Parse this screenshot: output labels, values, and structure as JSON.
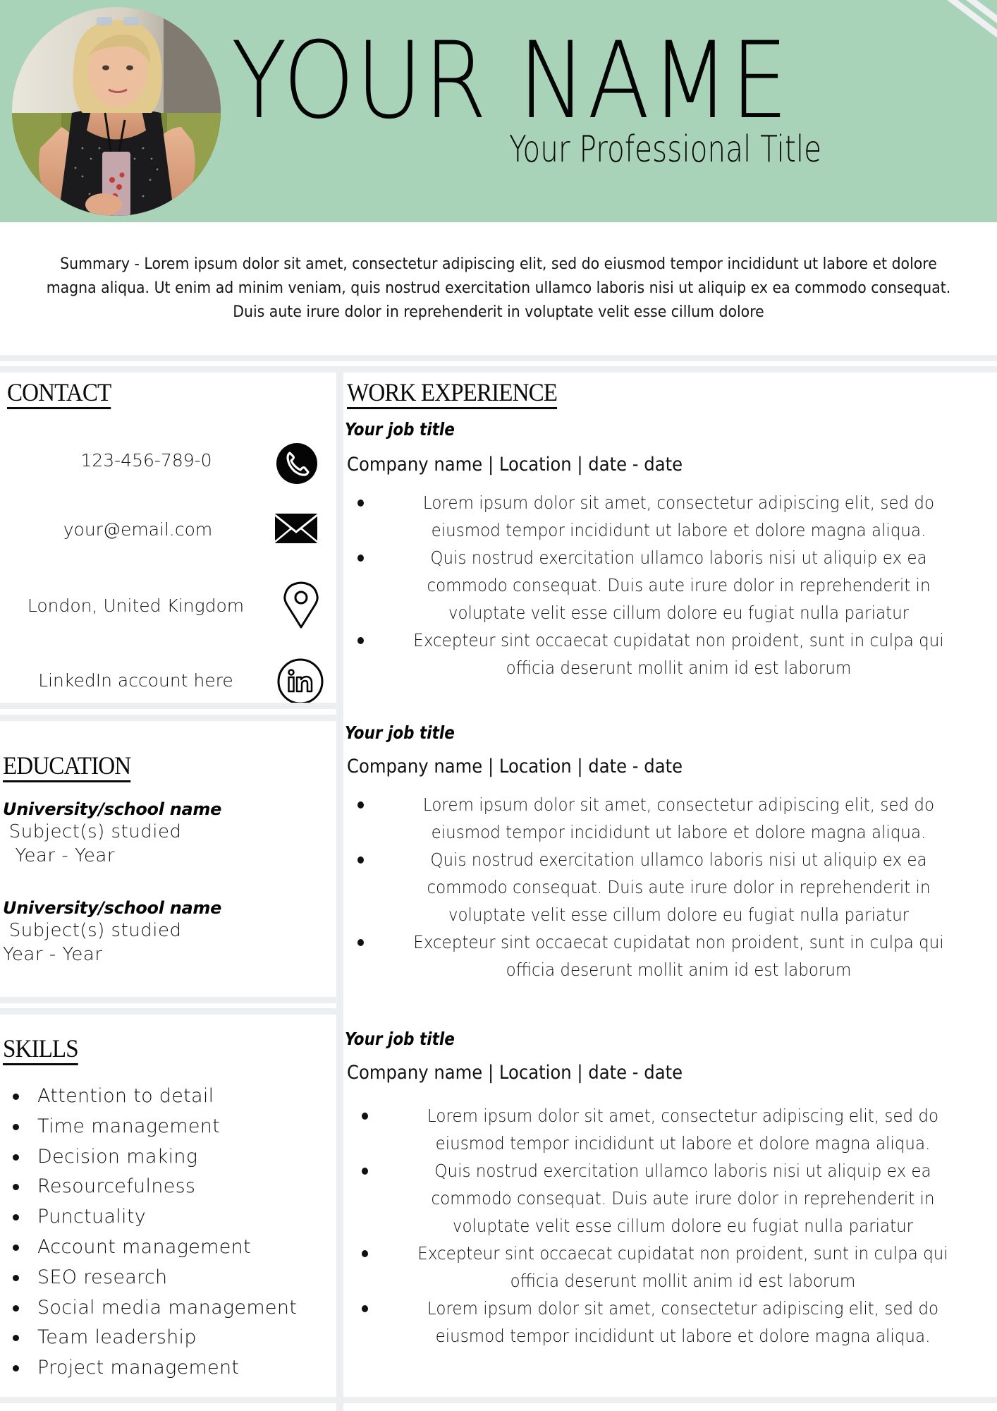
{
  "header": {
    "name": "YOUR NAME",
    "professional_title": "Your Professional Title",
    "accent_color": "#a8d3b9",
    "photo": "profile-photo"
  },
  "summary": "Summary - Lorem ipsum dolor sit amet, consectetur adipiscing elit, sed do eiusmod tempor incididunt ut labore et dolore magna aliqua. Ut enim ad minim veniam, quis nostrud exercitation ullamco laboris nisi ut aliquip ex ea commodo consequat. Duis aute irure dolor in reprehenderit in voluptate velit esse cillum dolore",
  "contact": {
    "heading": "CONTACT",
    "items": [
      {
        "text": "123-456-789-0",
        "icon": "phone-icon"
      },
      {
        "text": "your@email.com",
        "icon": "email-icon"
      },
      {
        "text": "London, United Kingdom",
        "icon": "location-pin-icon"
      },
      {
        "text": "LinkedIn account here",
        "icon": "linkedin-icon"
      }
    ]
  },
  "education": {
    "heading": "EDUCATION",
    "items": [
      {
        "school": "University/school name",
        "subjects": " Subject(s) studied",
        "years": "  Year - Year"
      },
      {
        "school": "University/school name",
        "subjects": " Subject(s) studied",
        "years": "Year - Year"
      }
    ]
  },
  "skills": {
    "heading": "SKILLS",
    "items": [
      "Attention to detail",
      "Time management",
      "Decision making",
      "Resourcefulness",
      "Punctuality",
      "Account management",
      "SEO research",
      "Social media management",
      "Team leadership",
      "Project management"
    ]
  },
  "work": {
    "heading": "WORK EXPERIENCE",
    "jobs": [
      {
        "title": "Your job title",
        "meta": "Company name | Location | date - date",
        "bullets": [
          "Lorem ipsum dolor sit amet, consectetur adipiscing elit, sed do eiusmod tempor incididunt ut labore et dolore magna aliqua.",
          "Quis nostrud exercitation ullamco laboris nisi ut aliquip ex ea commodo consequat. Duis aute irure dolor in reprehenderit in voluptate velit esse cillum dolore eu fugiat nulla pariatur",
          "Excepteur sint occaecat cupidatat non proident, sunt in culpa qui officia deserunt mollit anim id est laborum"
        ]
      },
      {
        "title": "Your job title",
        "meta": "Company name | Location | date - date",
        "bullets": [
          "Lorem ipsum dolor sit amet, consectetur adipiscing elit, sed do eiusmod tempor incididunt ut labore et dolore magna aliqua.",
          "Quis nostrud exercitation ullamco laboris nisi ut aliquip ex ea commodo consequat. Duis aute irure dolor in reprehenderit in voluptate velit esse cillum dolore eu fugiat nulla pariatur",
          "Excepteur sint occaecat cupidatat non proident, sunt in culpa qui officia deserunt mollit anim id est laborum"
        ]
      },
      {
        "title": "Your job title",
        "meta": "Company name | Location | date - date",
        "bullets": [
          "Lorem ipsum dolor sit amet, consectetur adipiscing elit, sed do eiusmod tempor incididunt ut labore et dolore magna aliqua.",
          "Quis nostrud exercitation ullamco laboris nisi ut aliquip ex ea commodo consequat. Duis aute irure dolor in reprehenderit in voluptate velit esse cillum dolore eu fugiat nulla pariatur",
          "Excepteur sint occaecat cupidatat non proident, sunt in culpa qui officia deserunt mollit anim id est laborum",
          "Lorem ipsum dolor sit amet, consectetur adipiscing elit, sed do eiusmod tempor incididunt ut labore et dolore magna aliqua."
        ]
      }
    ]
  }
}
